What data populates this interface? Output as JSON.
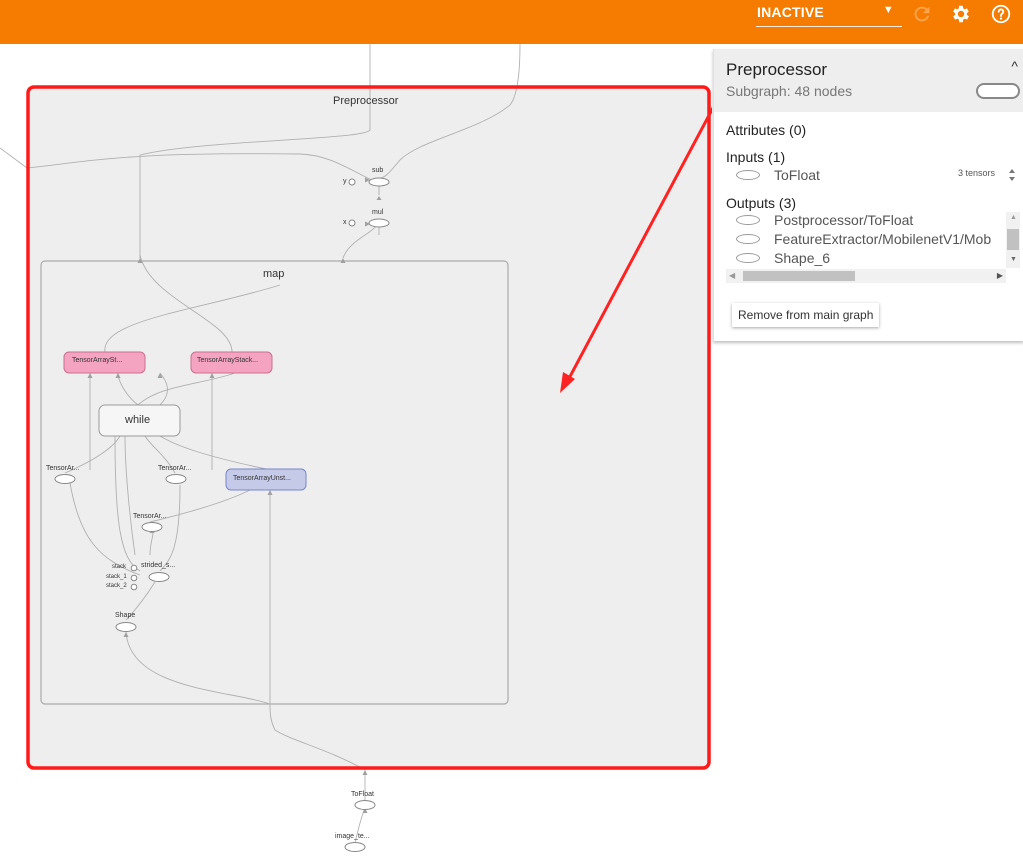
{
  "toolbar": {
    "run_selector_value": "INACTIVE",
    "icons": [
      "dropdown-caret-icon",
      "refresh-icon",
      "gear-icon",
      "help-icon"
    ]
  },
  "graph": {
    "preprocessor_label": "Preprocessor",
    "map_label": "map",
    "nodes": {
      "sub": "sub",
      "mul": "mul",
      "y": "y",
      "x": "x",
      "tensor_array_stack_1": "TensorArraySt...",
      "tensor_array_stack_2": "TensorArrayStack...",
      "while": "while",
      "tensor_ar_left": "TensorAr...",
      "tensor_ar_mid": "TensorAr...",
      "tensor_array_unstack": "TensorArrayUnst...",
      "tensor_ar_lower": "TensorAr...",
      "strided_slice": "strided_s...",
      "stack": "stack",
      "stack_1": "stack_1",
      "stack_2": "stack_2",
      "shape": "Shape",
      "to_float": "ToFloat",
      "image_tensor": "image_te..."
    }
  },
  "info_panel": {
    "title": "Preprocessor",
    "subtitle": "Subgraph: 48 nodes",
    "attributes_header": "Attributes (0)",
    "inputs_header": "Inputs (1)",
    "inputs": [
      {
        "name": "ToFloat",
        "detail": "3 tensors"
      }
    ],
    "outputs_header": "Outputs (3)",
    "outputs": [
      "Postprocessor/ToFloat",
      "FeatureExtractor/MobilenetV1/Mob",
      "Shape_6"
    ],
    "remove_button": "Remove from main graph"
  },
  "colors": {
    "header_orange": "#f57c00",
    "pink_node": "#f4a3c0",
    "blue_node": "#c5cae9",
    "highlight_red": "#ff1a1a"
  }
}
